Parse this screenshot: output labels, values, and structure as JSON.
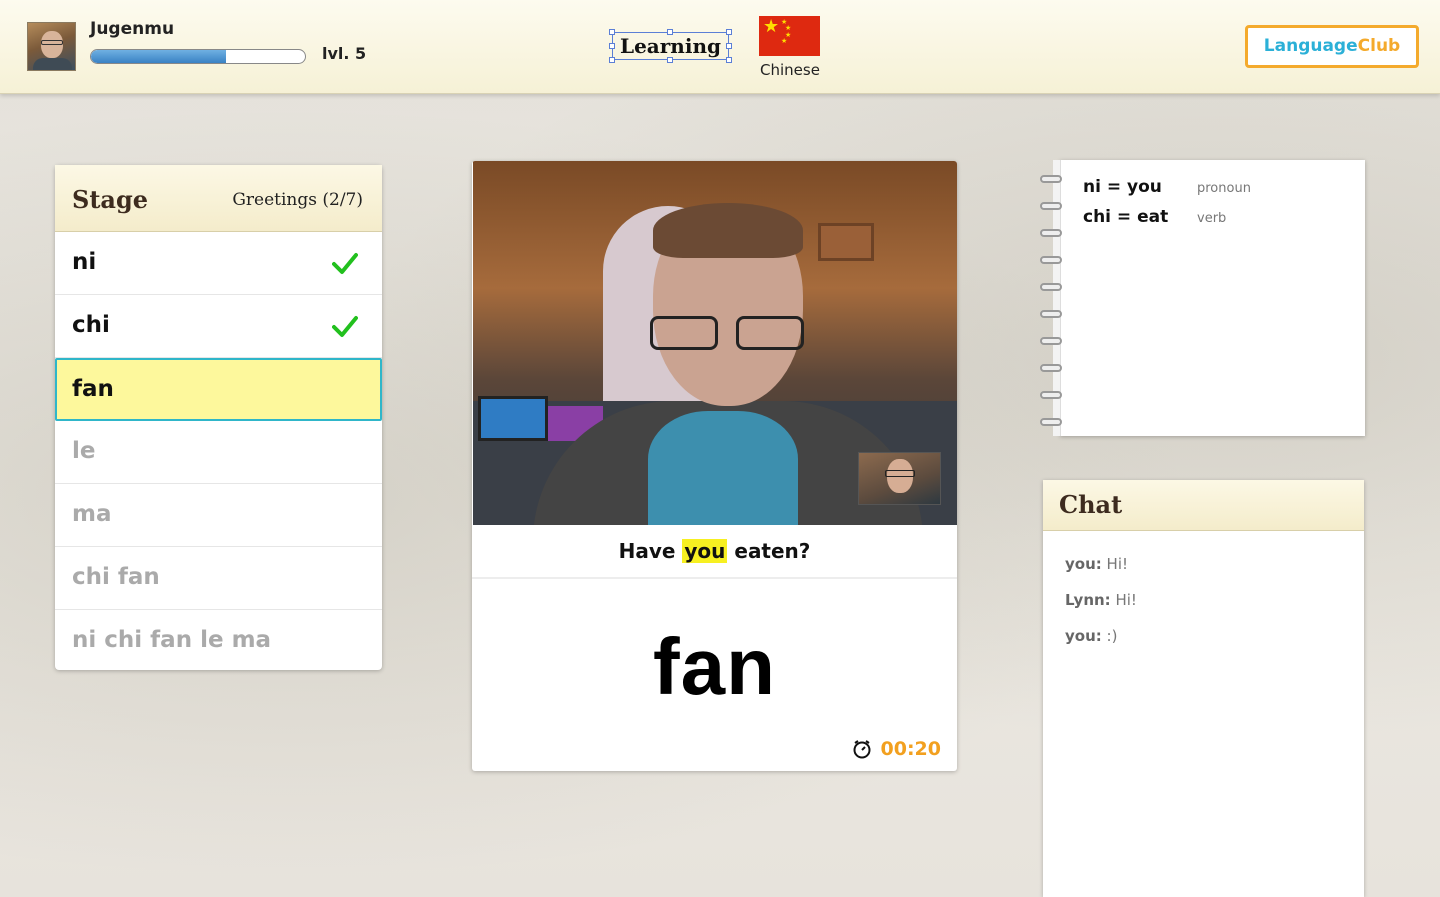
{
  "header": {
    "username": "Jugenmu",
    "level": "lvl. 5",
    "xp_progress": 0.63,
    "mode_label": "Learning",
    "language": "Chinese",
    "logo": {
      "part1": "Language",
      "part2": "Club"
    }
  },
  "stage": {
    "title": "Stage",
    "progress": "Greetings (2/7)",
    "items": [
      {
        "label": "ni",
        "status": "done"
      },
      {
        "label": "chi",
        "status": "done"
      },
      {
        "label": "fan",
        "status": "current"
      },
      {
        "label": "le",
        "status": "todo"
      },
      {
        "label": "ma",
        "status": "todo"
      },
      {
        "label": "chi fan",
        "status": "todo"
      },
      {
        "label": "ni chi fan le ma",
        "status": "todo"
      }
    ]
  },
  "lesson": {
    "sentence_before": "Have",
    "sentence_highlight": "you",
    "sentence_after": "eaten?",
    "current_word": "fan",
    "timer": "00:20"
  },
  "notebook": {
    "entries": [
      {
        "term": "ni = you",
        "pos": "pronoun"
      },
      {
        "term": "chi = eat",
        "pos": "verb"
      }
    ]
  },
  "chat": {
    "title": "Chat",
    "messages": [
      {
        "who": "you:",
        "text": "Hi!"
      },
      {
        "who": "Lynn:",
        "text": "Hi!"
      },
      {
        "who": "you:",
        "text": ":)"
      }
    ]
  },
  "colors": {
    "accent_blue": "#3a82c4",
    "accent_orange": "#f2a01f",
    "check_green": "#22c01e",
    "highlight_yellow": "#f7f021",
    "current_border": "#2fb6c9"
  }
}
